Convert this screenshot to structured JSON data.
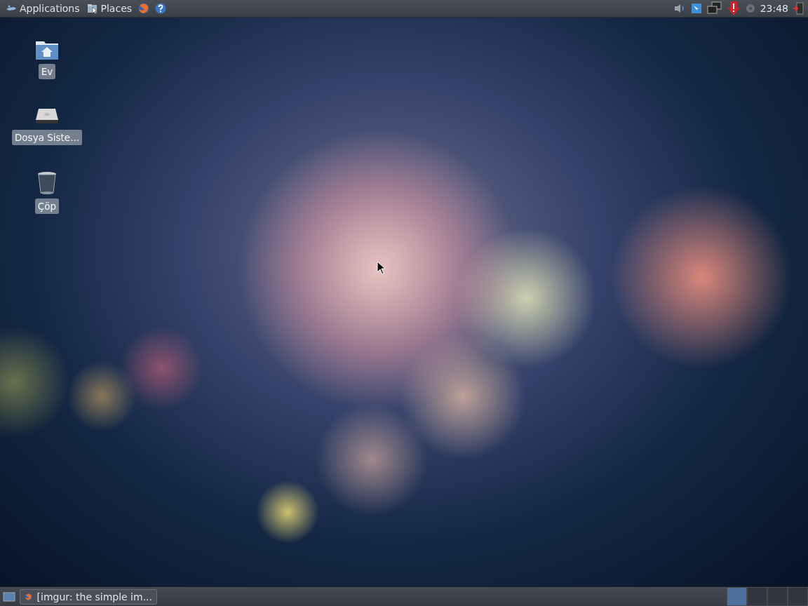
{
  "top_panel": {
    "menus": [
      {
        "label": "Applications",
        "kind": "applications"
      },
      {
        "label": "Places",
        "kind": "places"
      }
    ],
    "clock": "23:48"
  },
  "desktop_icons": [
    {
      "label": "Ev",
      "kind": "home",
      "selected": false
    },
    {
      "label": "Dosya Siste...",
      "kind": "drive",
      "selected": false
    },
    {
      "label": "Çöp",
      "kind": "trash",
      "selected": false
    }
  ],
  "bottom_panel": {
    "tasks": [
      {
        "label": "[imgur: the simple im...",
        "selected": false
      }
    ],
    "workspaces": [
      {
        "selected": true
      },
      {
        "selected": false
      },
      {
        "selected": false
      },
      {
        "selected": false
      }
    ]
  }
}
